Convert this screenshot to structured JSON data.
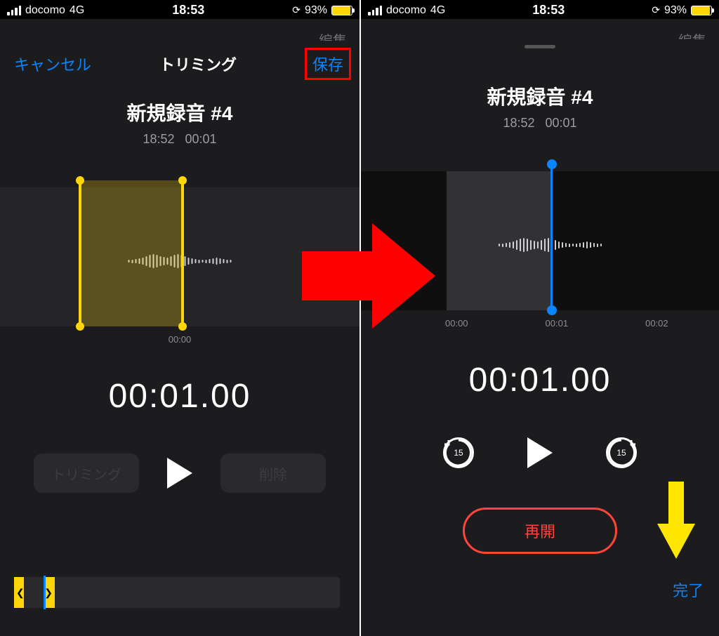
{
  "status": {
    "carrier": "docomo",
    "network": "4G",
    "time": "18:53",
    "battery_pct": "93%"
  },
  "edit_label": "編集",
  "left": {
    "cancel": "キャンセル",
    "title": "トリミング",
    "save": "保存",
    "rec_title": "新規録音 #4",
    "rec_time": "18:52",
    "rec_dur": "00:01",
    "ruler": [
      "00:00"
    ],
    "big_time": "00:01.00",
    "trim_btn": "トリミング",
    "delete_btn": "削除"
  },
  "right": {
    "rec_title": "新規録音 #4",
    "rec_time": "18:52",
    "rec_dur": "00:01",
    "ruler": [
      "00:00",
      "00:01",
      "00:02"
    ],
    "big_time": "00:01.00",
    "skip": "15",
    "resume": "再開",
    "done": "完了"
  }
}
